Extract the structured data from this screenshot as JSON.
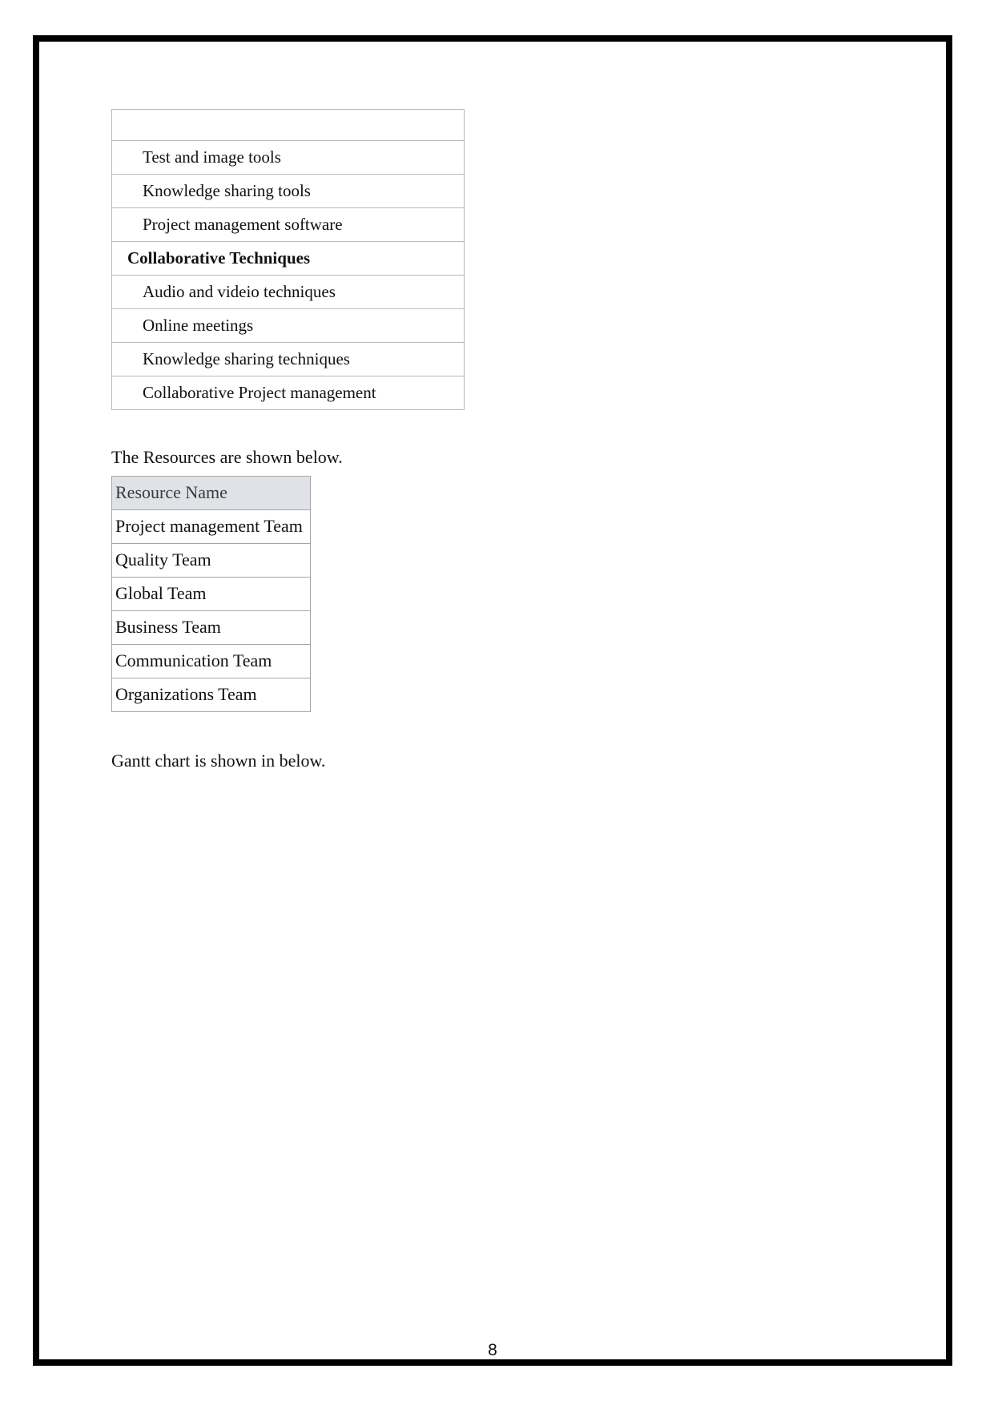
{
  "document": {
    "page_number": "8"
  },
  "tools_table": {
    "rows": [
      {
        "label": "",
        "style": "spacer"
      },
      {
        "label": "Test and image tools",
        "style": "item"
      },
      {
        "label": "Knowledge sharing tools",
        "style": "item"
      },
      {
        "label": "Project management software",
        "style": "item"
      },
      {
        "label": "Collaborative Techniques",
        "style": "heading"
      },
      {
        "label": "Audio and videio techniques",
        "style": "item"
      },
      {
        "label": "Online meetings",
        "style": "item"
      },
      {
        "label": "Knowledge sharing techniques",
        "style": "item"
      },
      {
        "label": "Collaborative Project management",
        "style": "item"
      }
    ]
  },
  "resources_intro": "The Resources are shown below.",
  "resource_table": {
    "header": "Resource Name",
    "rows": [
      "Project management Team",
      "Quality Team",
      "Global Team",
      "Business Team",
      "Communication Team",
      "Organizations Team"
    ]
  },
  "gantt_intro": "Gantt chart is shown in below.",
  "colors": {
    "page_border": "#000000",
    "table_border": "#b9b9b9",
    "resource_header_bg": "#dfe3e8",
    "text": "#111111"
  }
}
